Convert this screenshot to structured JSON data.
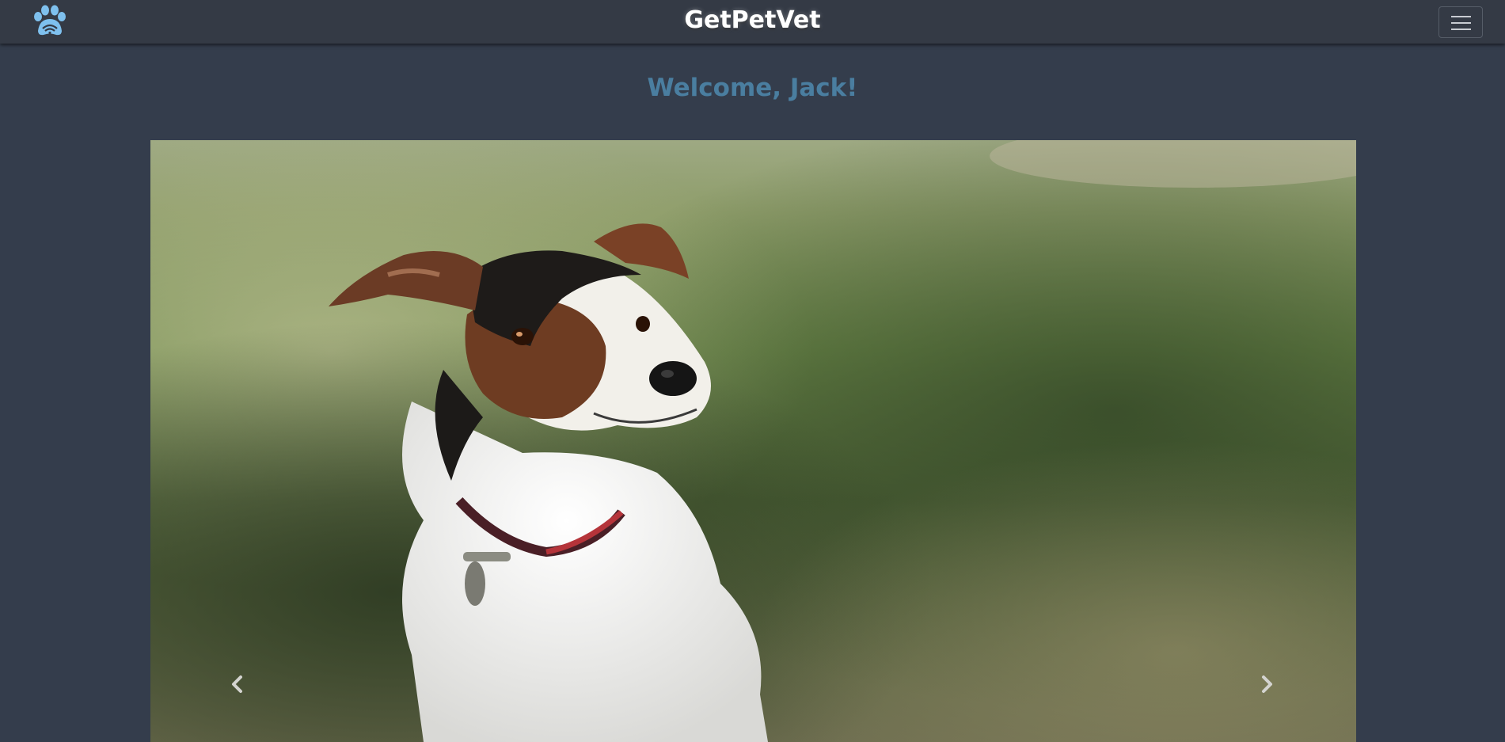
{
  "header": {
    "brand": "GetPetVet",
    "logo_icon": "paw-wifi-icon",
    "menu_icon": "hamburger-menu-icon"
  },
  "main": {
    "welcome_text": "Welcome, Jack!"
  },
  "carousel": {
    "slide_image": "dog-photo",
    "prev_icon": "chevron-left-icon",
    "next_icon": "chevron-right-icon"
  },
  "colors": {
    "page_background": "#343d4c",
    "navbar_background": "#343a45",
    "welcome_text": "#4a7ea0",
    "logo_accent": "#6fb4e6"
  }
}
